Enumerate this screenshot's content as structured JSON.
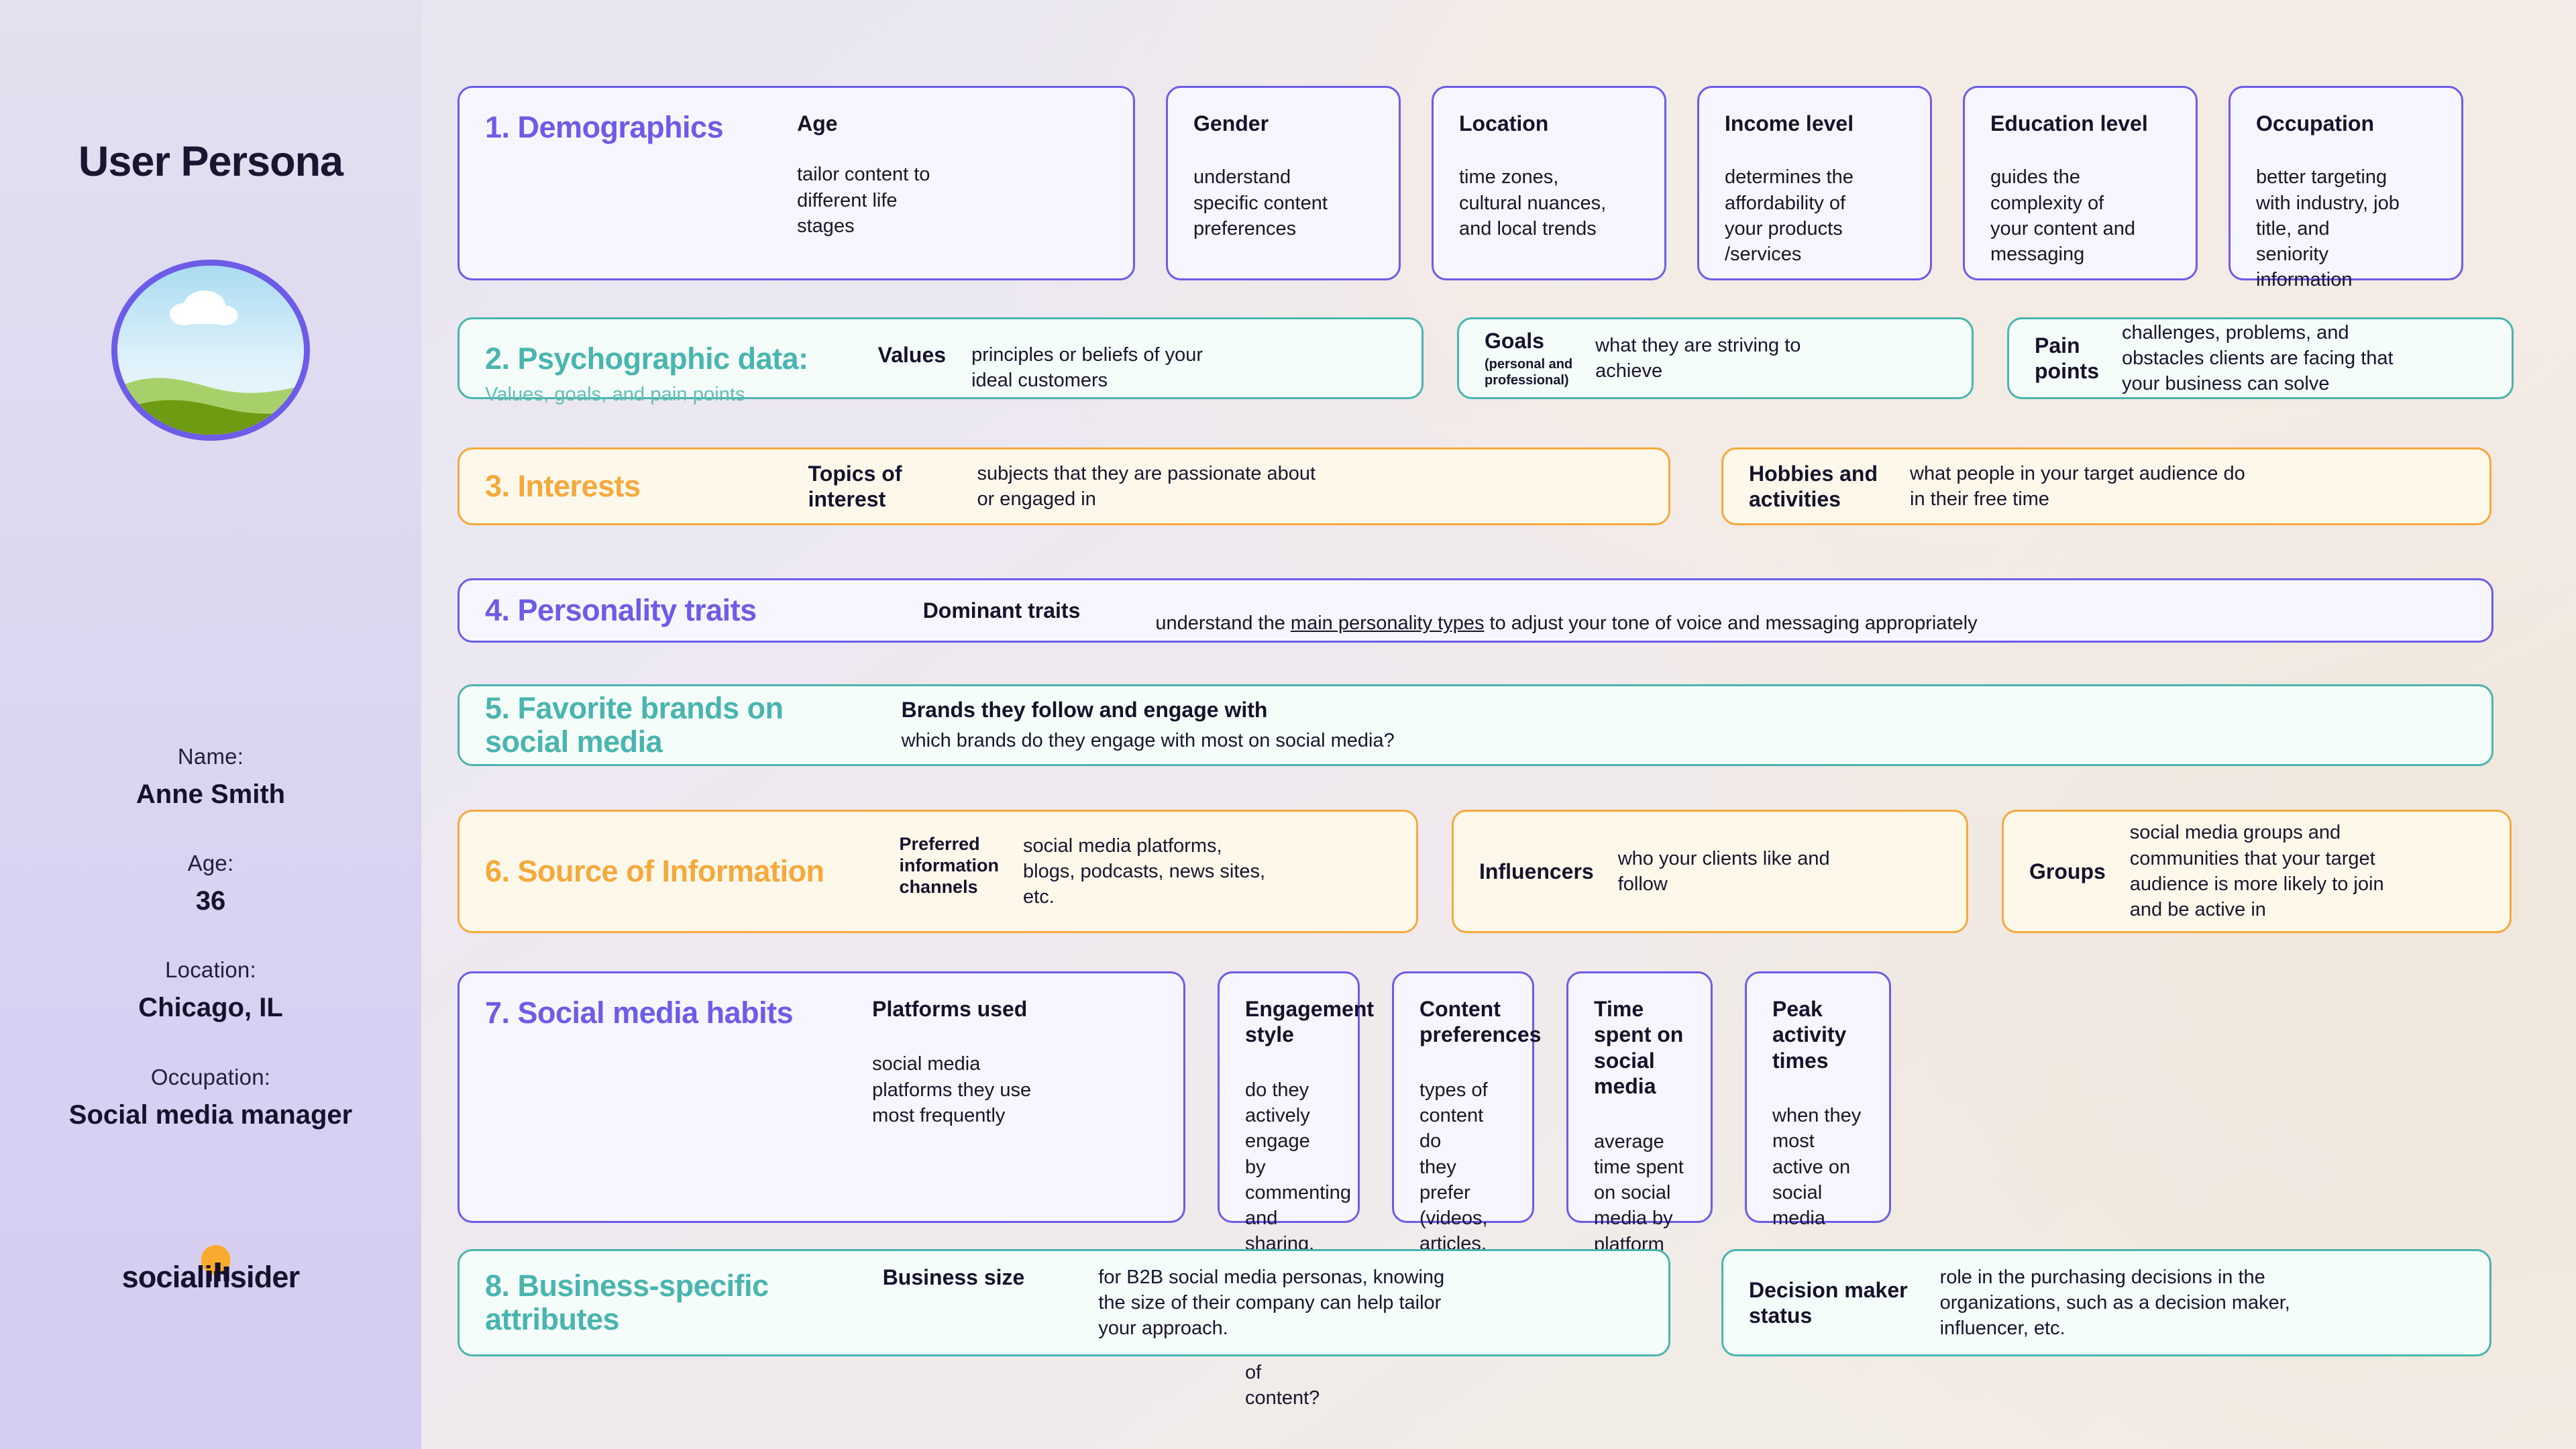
{
  "sidebar": {
    "title": "User Persona",
    "avatar_alt": "landscape-avatar",
    "fields": [
      {
        "label": "Name:",
        "value": "Anne Smith"
      },
      {
        "label": "Age:",
        "value": "36"
      },
      {
        "label": "Location:",
        "value": "Chicago, IL"
      },
      {
        "label": "Occupation:",
        "value": "Social media\nmanager"
      }
    ],
    "logo": "socialinsider"
  },
  "colors": {
    "purple": "#6c5ce7",
    "teal": "#49b5ae",
    "amber": "#f5a93c",
    "ink": "#15122b"
  },
  "sections": [
    {
      "id": "demographics",
      "number_title": "1. Demographics",
      "subtitle": "",
      "accent": "purple",
      "items": [
        {
          "label": "Age",
          "desc": "tailor content to\ndifferent life\nstages"
        },
        {
          "label": "Gender",
          "desc": "understand\nspecific content\npreferences"
        },
        {
          "label": "Location",
          "desc": "time zones,\ncultural nuances,\nand local trends"
        },
        {
          "label": "Income level",
          "desc": "determines the\naffordability of\nyour products\n/services"
        },
        {
          "label": "Education level",
          "desc": "guides the\ncomplexity of\nyour content and\nmessaging"
        },
        {
          "label": "Occupation",
          "desc": "better targeting\nwith industry, job\ntitle, and\nseniority\ninformation"
        }
      ]
    },
    {
      "id": "psychographic",
      "number_title": "2. Psychographic data:",
      "subtitle": "Values, goals, and pain points",
      "accent": "teal",
      "items": [
        {
          "label": "Values",
          "sub": "",
          "desc": "principles or beliefs of your\nideal customers"
        },
        {
          "label": "Goals",
          "sub": "(personal and\nprofessional)",
          "desc": "what they are striving to\nachieve"
        },
        {
          "label": "Pain\npoints",
          "sub": "",
          "desc": "challenges, problems, and\nobstacles clients are facing that\nyour business can solve"
        }
      ]
    },
    {
      "id": "interests",
      "number_title": "3. Interests",
      "subtitle": "",
      "accent": "amber",
      "items": [
        {
          "label": "Topics of\ninterest",
          "desc": "subjects that they are passionate about\nor engaged in"
        },
        {
          "label": "Hobbies and\nactivities",
          "desc": "what people in your target audience do\nin their free time"
        }
      ]
    },
    {
      "id": "personality",
      "number_title": "4. Personality traits",
      "subtitle": "",
      "accent": "purple",
      "items": [
        {
          "label": "Dominant traits",
          "desc_pre": "understand the",
          "desc_link": "main personality types",
          "desc_post": "to adjust your tone of voice and messaging appropriately"
        }
      ]
    },
    {
      "id": "favorite-brands",
      "number_title": "5. Favorite brands on\nsocial media",
      "subtitle": "",
      "accent": "teal",
      "items": [
        {
          "label": "Brands they follow and engage with",
          "desc": "which brands do they engage with most on social media?"
        }
      ]
    },
    {
      "id": "source-of-information",
      "number_title": "6. Source of Information",
      "subtitle": "",
      "accent": "amber",
      "items": [
        {
          "label": "Preferred\ninformation\nchannels",
          "desc": "social media platforms,\nblogs, podcasts, news sites,\netc."
        },
        {
          "label": "Influencers",
          "desc": "who your clients like and\nfollow"
        },
        {
          "label": "Groups",
          "desc": "social media groups and\ncommunities that your target\naudience is more likely to join\nand be active in"
        }
      ]
    },
    {
      "id": "social-media-habits",
      "number_title": "7. Social media habits",
      "subtitle": "",
      "accent": "purple",
      "items": [
        {
          "label": "Platforms used",
          "desc": "social media\nplatforms they use\nmost frequently"
        },
        {
          "label": "Engagement\nstyle",
          "desc": "do they actively\nengage by\ncommenting and\nsharing, or are they\npassive consumers\nof content?"
        },
        {
          "label": "Content\npreferences",
          "desc": "types of content do\nthey prefer (videos,\narticles,\ninfographics,\nmemes, etc.)"
        },
        {
          "label": "Time spent on\nsocial media",
          "desc": "average time spent\non social media by\nplatform"
        },
        {
          "label": "Peak activity\ntimes",
          "desc": "when they most\nactive on social\nmedia"
        }
      ]
    },
    {
      "id": "business-specific",
      "number_title": "8. Business-specific\nattributes",
      "subtitle": "",
      "accent": "teal",
      "items": [
        {
          "label": "Business size",
          "desc": "for B2B social media personas, knowing\nthe size of their company can help tailor\nyour approach."
        },
        {
          "label": "Decision maker\nstatus",
          "desc": "role in the purchasing decisions in the\norganizations, such as a decision maker,\ninfluencer, etc."
        }
      ]
    }
  ]
}
